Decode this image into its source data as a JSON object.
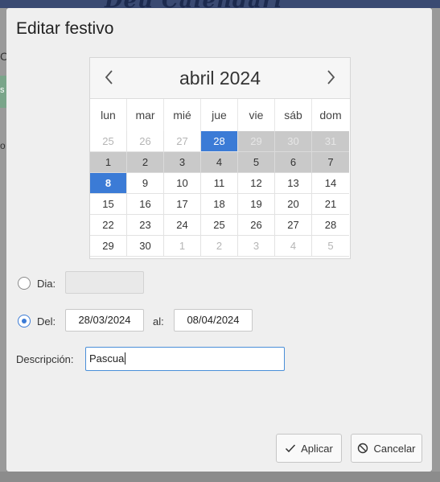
{
  "background": {
    "banner_text": "Deu Calendari",
    "left_glyph_top": "C",
    "left_glyph_mid": "s",
    "left_glyph_low": "o"
  },
  "dialog": {
    "title": "Editar festivo",
    "calendar": {
      "month_label": "abril 2024",
      "weekdays": [
        "lun",
        "mar",
        "mié",
        "jue",
        "vie",
        "sáb",
        "dom"
      ],
      "weeks": [
        [
          {
            "d": "25",
            "other": true
          },
          {
            "d": "26",
            "other": true
          },
          {
            "d": "27",
            "other": true
          },
          {
            "d": "28",
            "sel": true
          },
          {
            "d": "29",
            "other": true,
            "range": true
          },
          {
            "d": "30",
            "other": true,
            "range": true
          },
          {
            "d": "31",
            "other": true,
            "range": true
          }
        ],
        [
          {
            "d": "1",
            "range": true
          },
          {
            "d": "2",
            "range": true
          },
          {
            "d": "3",
            "range": true
          },
          {
            "d": "4",
            "range": true
          },
          {
            "d": "5",
            "range": true
          },
          {
            "d": "6",
            "range": true
          },
          {
            "d": "7",
            "range": true
          }
        ],
        [
          {
            "d": "8",
            "sel": true,
            "bold": true
          },
          {
            "d": "9"
          },
          {
            "d": "10"
          },
          {
            "d": "11"
          },
          {
            "d": "12"
          },
          {
            "d": "13"
          },
          {
            "d": "14"
          }
        ],
        [
          {
            "d": "15"
          },
          {
            "d": "16"
          },
          {
            "d": "17"
          },
          {
            "d": "18"
          },
          {
            "d": "19"
          },
          {
            "d": "20"
          },
          {
            "d": "21"
          }
        ],
        [
          {
            "d": "22"
          },
          {
            "d": "23"
          },
          {
            "d": "24"
          },
          {
            "d": "25"
          },
          {
            "d": "26"
          },
          {
            "d": "27"
          },
          {
            "d": "28"
          }
        ],
        [
          {
            "d": "29"
          },
          {
            "d": "30"
          },
          {
            "d": "1",
            "other": true
          },
          {
            "d": "2",
            "other": true
          },
          {
            "d": "3",
            "other": true
          },
          {
            "d": "4",
            "other": true
          },
          {
            "d": "5",
            "other": true
          }
        ]
      ]
    },
    "day_option": {
      "label": "Dia:",
      "value": ""
    },
    "range_option": {
      "label": "Del:",
      "from": "28/03/2024",
      "to_label": "al:",
      "to": "08/04/2024"
    },
    "description": {
      "label": "Descripción:",
      "value": "Pascua"
    },
    "buttons": {
      "apply": "Aplicar",
      "cancel": "Cancelar"
    },
    "colors": {
      "accent": "#3b7bd6",
      "range": "#c9c9c9"
    },
    "icons": {
      "apply": "check-icon",
      "cancel": "cancel-circle-icon",
      "prev": "chevron-left-icon",
      "next": "chevron-right-icon"
    }
  }
}
